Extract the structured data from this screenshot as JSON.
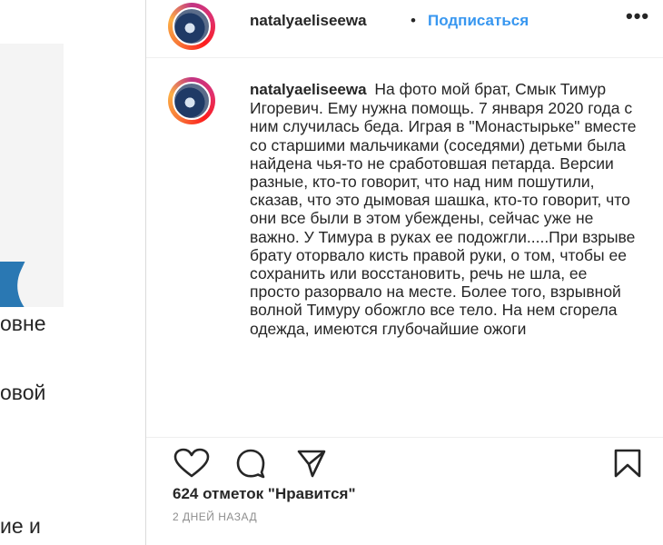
{
  "left": {
    "fragments": [
      "овне",
      "овой",
      "ие и"
    ]
  },
  "post": {
    "username": "natalyaeliseewa",
    "separator": "•",
    "follow_label": "Подписаться",
    "more_label": "•••",
    "caption_text": "На фото мой брат, Смык Тимур Игоревич. Ему нужна помощь. 7 января 2020 года с ним случилась беда. Играя в \"Монастырьке\" вместе со старшими мальчиками (соседями) детьми была найдена чья-то не сработовшая петарда. Версии разные, кто-то говорит, что над ним пошутили, сказав, что это дымовая шашка, кто-то говорит, что они все были в этом убеждены, сейчас уже не важно. У Тимура в руках ее подожгли.....При взрыве брату оторвало кисть правой руки, о том, чтобы ее сохранить или восстановить, речь не шла, ее просто разорвало на месте. Более того, взрывной волной Тимуру обожгло все тело. На нем сгорела одежда, имеются глубочайшие ожоги",
    "likes": "624 отметок \"Нравится\"",
    "time": "2 ДНЕЙ НАЗАД"
  },
  "icons": {
    "like": "heart-icon",
    "comment": "comment-icon",
    "share": "paper-plane-icon",
    "save": "bookmark-icon"
  }
}
